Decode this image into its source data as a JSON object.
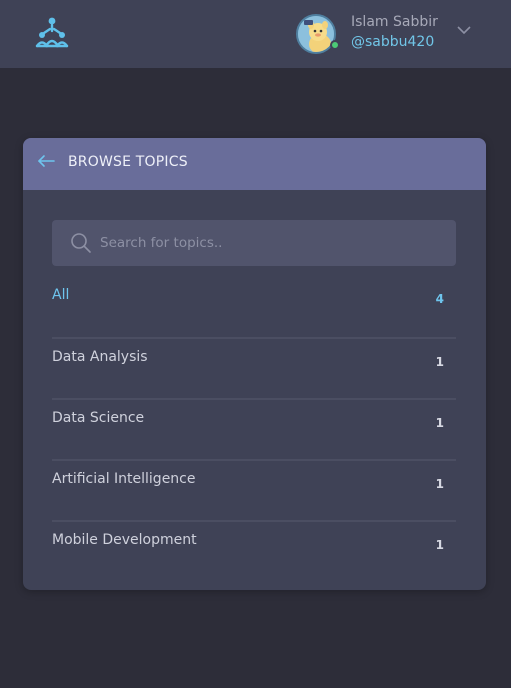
{
  "header": {
    "user": {
      "name": "Islam Sabbir",
      "handle": "@sabbu420",
      "status": "online"
    }
  },
  "browse": {
    "title": "BROWSE TOPICS",
    "search": {
      "placeholder": "Search for topics..",
      "value": ""
    },
    "topics": [
      {
        "label": "All",
        "count": "4",
        "active": true
      },
      {
        "label": "Data Analysis",
        "count": "1",
        "active": false
      },
      {
        "label": "Data Science",
        "count": "1",
        "active": false
      },
      {
        "label": "Artificial Intelligence",
        "count": "1",
        "active": false
      },
      {
        "label": "Mobile Development",
        "count": "1",
        "active": false
      }
    ]
  },
  "colors": {
    "accent": "#6ec5ee",
    "header_bg": "#3f4256",
    "card_header_bg": "#696d9a",
    "page_bg": "#2d2d39",
    "online": "#4ccb76"
  },
  "icons": {
    "logo": "network-logo-icon",
    "chevron": "chevron-down-icon",
    "back": "arrow-left-icon",
    "search": "search-icon"
  }
}
